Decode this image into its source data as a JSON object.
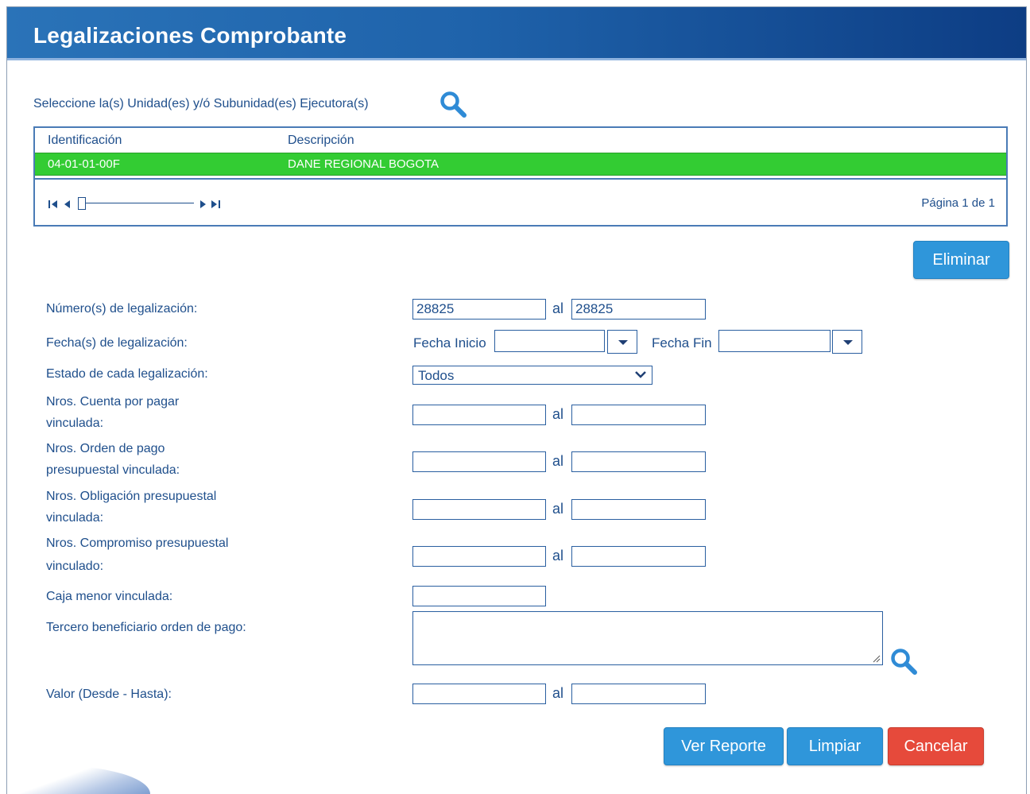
{
  "window": {
    "title": "Legalizaciones Comprobante"
  },
  "units": {
    "select_label": "Seleccione la(s) Unidad(es) y/ó Subunidad(es) Ejecutora(s)",
    "search_icon": "magnifier-icon",
    "columns": [
      "Identificación",
      "Descripción"
    ],
    "rows": [
      {
        "identificacion": "04-01-01-00F",
        "descripcion": "DANE REGIONAL BOGOTA"
      }
    ],
    "pager": {
      "first": "I◀",
      "prev": "◀",
      "next": "▶",
      "last": "▶I",
      "page_info": "Página 1 de 1"
    },
    "delete_button": "Eliminar"
  },
  "form": {
    "numero": {
      "label": "Número(s) de legalización:",
      "from": "28825",
      "to": "28825",
      "sep": "al"
    },
    "fecha": {
      "label": "Fecha(s) de legalización:",
      "inicio_label": "Fecha Inicio",
      "fin_label": "Fecha Fin",
      "inicio": "",
      "fin": ""
    },
    "estado": {
      "label": "Estado de cada legalización:",
      "value": "Todos"
    },
    "cuenta_pagar": {
      "label_line1": "Nros. Cuenta por pagar",
      "label_line2": "vinculada:",
      "from": "",
      "to": "",
      "sep": "al"
    },
    "orden_pago": {
      "label_line1": "Nros. Orden de pago",
      "label_line2": "presupuestal vinculada:",
      "from": "",
      "to": "",
      "sep": "al"
    },
    "obligacion": {
      "label_line1": "Nros. Obligación presupuestal",
      "label_line2": "vinculada:",
      "from": "",
      "to": "",
      "sep": "al"
    },
    "compromiso": {
      "label_line1": "Nros. Compromiso presupuestal",
      "label_line2": "vinculado:",
      "from": "",
      "to": "",
      "sep": "al"
    },
    "caja_menor": {
      "label": "Caja menor vinculada:",
      "value": ""
    },
    "tercero": {
      "label": "Tercero beneficiario orden de pago:",
      "value": ""
    },
    "valor": {
      "label": "Valor (Desde - Hasta):",
      "from": "",
      "to": "",
      "sep": "al"
    }
  },
  "actions": {
    "ver_reporte": "Ver Reporte",
    "limpiar": "Limpiar",
    "cancelar": "Cancelar"
  },
  "colors": {
    "title_bar": "#1f63ab",
    "selected_row": "#33cc33",
    "primary_button": "#2f96da",
    "danger_button": "#e64a3b",
    "text": "#1f4f8c"
  }
}
